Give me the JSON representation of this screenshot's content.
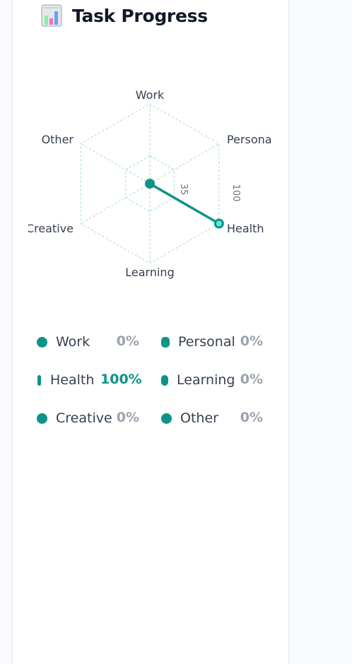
{
  "header": {
    "title": "Task Progress",
    "icon": "bar-chart-icon"
  },
  "colors": {
    "accent": "#0d9488",
    "grid": "#99d9c9",
    "muted": "#9ca3af",
    "text": "#374151"
  },
  "chart_data": {
    "type": "radar",
    "axes": [
      "Work",
      "Personal",
      "Health",
      "Learning",
      "Creative",
      "Other"
    ],
    "series": [
      {
        "values": [
          0,
          0,
          100,
          0,
          0,
          0
        ]
      }
    ],
    "tick_labels": [
      "35",
      "100"
    ],
    "range": [
      0,
      100
    ]
  },
  "legend": [
    {
      "name": "Work",
      "percent": "0%"
    },
    {
      "name": "Personal",
      "percent": "0%"
    },
    {
      "name": "Health",
      "percent": "100%"
    },
    {
      "name": "Learning",
      "percent": "0%"
    },
    {
      "name": "Creative",
      "percent": "0%"
    },
    {
      "name": "Other",
      "percent": "0%"
    }
  ]
}
